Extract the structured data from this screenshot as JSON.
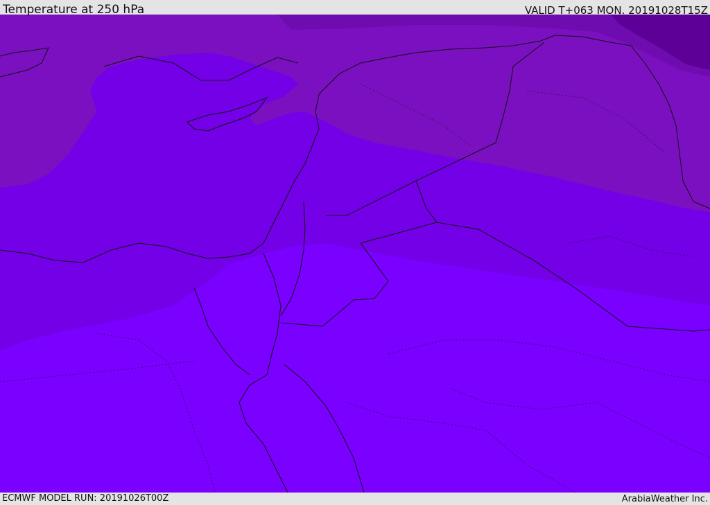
{
  "header": {
    "title": "Temperature at 250 hPa",
    "valid_time": "VALID T+063 MON. 20191028T15Z"
  },
  "footer": {
    "model_run": "ECMWF MODEL RUN: 20191026T00Z",
    "credit": "ArabiaWeather Inc."
  },
  "map": {
    "field": "temperature",
    "level": "250 hPa",
    "colors": {
      "warmest": "#7a00ff",
      "warm": "#7300e6",
      "cool": "#7a10c0",
      "cold": "#6e0cb0",
      "coldest": "#5c0098",
      "coastline": "#111111"
    }
  }
}
